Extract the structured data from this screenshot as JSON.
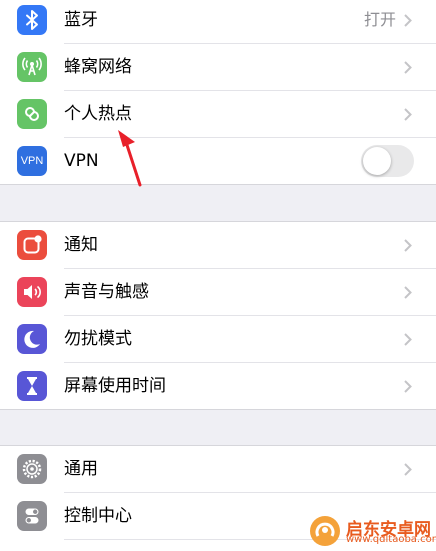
{
  "group1": {
    "items": [
      {
        "label": "蓝牙",
        "value": "打开",
        "icon": "bluetooth-icon",
        "color": "#3478f6"
      },
      {
        "label": "蜂窝网络",
        "icon": "cellular-icon",
        "color": "#65c466"
      },
      {
        "label": "个人热点",
        "icon": "hotspot-icon",
        "color": "#65c466"
      },
      {
        "label": "VPN",
        "icon": "vpn-icon",
        "icon_text": "VPN",
        "color": "#2f6fe0",
        "toggle": false
      }
    ]
  },
  "group2": {
    "items": [
      {
        "label": "通知",
        "icon": "notifications-icon",
        "color": "#eb4d3d"
      },
      {
        "label": "声音与触感",
        "icon": "sound-icon",
        "color": "#eb445a"
      },
      {
        "label": "勿扰模式",
        "icon": "moon-icon",
        "color": "#5856d6"
      },
      {
        "label": "屏幕使用时间",
        "icon": "hourglass-icon",
        "color": "#5856d6"
      }
    ]
  },
  "group3": {
    "items": [
      {
        "label": "通用",
        "icon": "gear-icon",
        "color": "#8e8e93"
      },
      {
        "label": "控制中心",
        "icon": "control-center-icon",
        "color": "#8e8e93"
      }
    ]
  },
  "watermark": {
    "text": "启东安卓网",
    "url": "www.qdltaoba.com"
  },
  "annotation": {
    "arrow_color": "#e8202a"
  }
}
